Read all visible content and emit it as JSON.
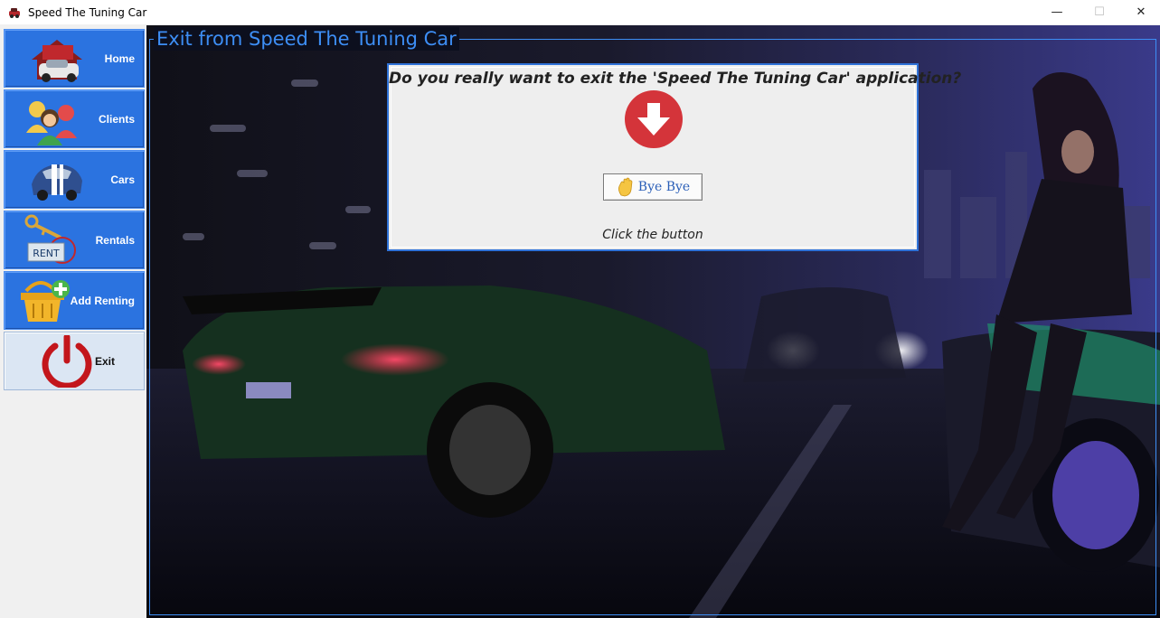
{
  "window": {
    "title": "Speed The Tuning Car",
    "minimize_glyph": "—",
    "maximize_glyph": "☐",
    "close_glyph": "✕"
  },
  "sidebar": {
    "items": [
      {
        "label": "Home",
        "icon": "home-car-icon"
      },
      {
        "label": "Clients",
        "icon": "clients-people-icon"
      },
      {
        "label": "Cars",
        "icon": "car-icon"
      },
      {
        "label": "Rentals",
        "icon": "rent-key-icon",
        "icon_text": "RENT"
      },
      {
        "label": "Add Renting",
        "icon": "add-basket-icon"
      },
      {
        "label": "Exit",
        "icon": "power-icon",
        "active": true
      }
    ]
  },
  "main": {
    "group_title": "Exit from Speed The Tuning Car",
    "background": "tuning-car-night-scene"
  },
  "dialog": {
    "question": "Do you really want to exit the 'Speed The Tuning Car' application?",
    "button_label": "Bye Bye",
    "hint": "Click the button"
  },
  "colors": {
    "accent": "#2b73e0",
    "title_blue": "#3d8ef5",
    "danger_red": "#d4343a"
  }
}
